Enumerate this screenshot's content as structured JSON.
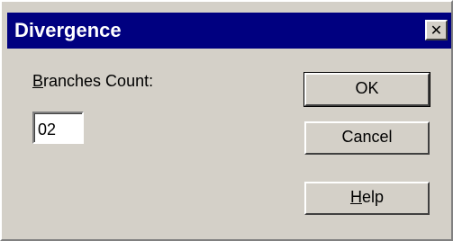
{
  "window": {
    "title": "Divergence",
    "close_symbol": "✕"
  },
  "form": {
    "label_prefix_underlined": "B",
    "label_rest": "ranches Count:",
    "branches_count_value": "02"
  },
  "buttons": {
    "ok_label": "OK",
    "cancel_label": "Cancel",
    "help_prefix_underlined": "H",
    "help_rest": "elp"
  },
  "colors": {
    "titlebar": "#000080",
    "dialog_face": "#d4d0c8"
  }
}
